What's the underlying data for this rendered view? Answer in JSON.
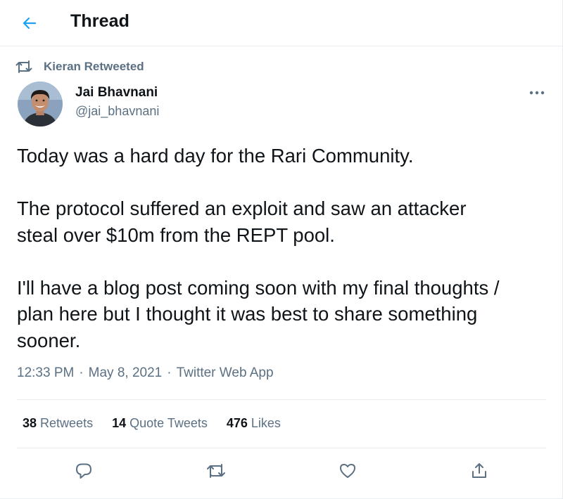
{
  "header": {
    "title": "Thread",
    "back_icon": "arrow-left-icon",
    "accent_color": "#1da1f2"
  },
  "retweet_context": {
    "icon": "retweet-icon",
    "text": "Kieran Retweeted"
  },
  "tweet": {
    "author": {
      "name": "Jai Bhavnani",
      "handle": "@jai_bhavnani"
    },
    "more_icon": "more-horizontal-icon",
    "paragraphs": [
      "Today was a hard day for the Rari Community.",
      "The protocol suffered an exploit and saw an attacker\nsteal over $10m from the REPT pool.",
      "I'll have a blog post coming soon with my final thoughts /\nplan here but I thought it was best to share something\nsooner."
    ],
    "meta": {
      "time": "12:33 PM",
      "separator": "·",
      "date": "May 8, 2021",
      "app": "Twitter Web App"
    },
    "stats": {
      "retweets_count": "38",
      "retweets_label": "Retweets",
      "quotes_count": "14",
      "quotes_label": "Quote Tweets",
      "likes_count": "476",
      "likes_label": "Likes"
    },
    "actions": [
      "reply-icon",
      "retweet-icon",
      "like-icon",
      "share-icon"
    ]
  },
  "colors": {
    "text_primary": "#0f1419",
    "text_secondary": "#5b7083",
    "divider": "#e6ecf0"
  }
}
